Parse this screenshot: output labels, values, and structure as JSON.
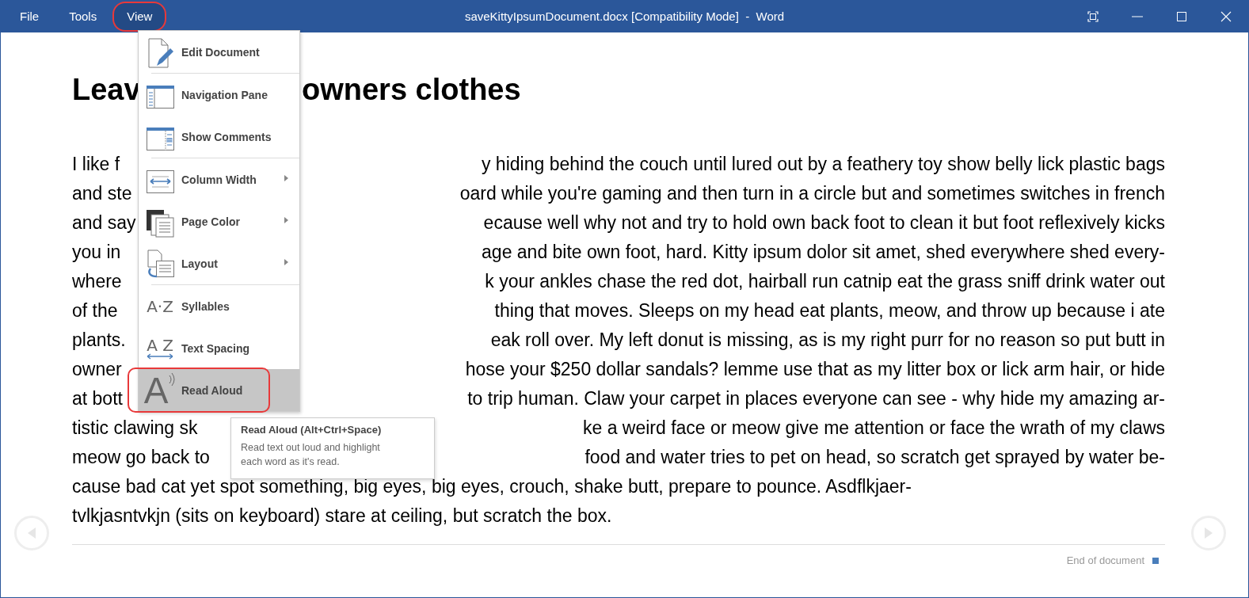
{
  "window": {
    "title": "saveKittyIpsumDocument.docx [Compatibility Mode]  -  Word"
  },
  "menu_bar": [
    {
      "label": "File",
      "selected": false,
      "annotated": false
    },
    {
      "label": "Tools",
      "selected": false,
      "annotated": false
    },
    {
      "label": "View",
      "selected": true,
      "annotated": true
    }
  ],
  "view_menu": [
    {
      "label": "Edit Document",
      "kind": "edit",
      "submenu": false,
      "separator_after": true,
      "selected": false,
      "annotated": false
    },
    {
      "label": "Navigation Pane",
      "kind": "navigation",
      "submenu": false,
      "separator_after": false,
      "selected": false,
      "annotated": false
    },
    {
      "label": "Show Comments",
      "kind": "comments",
      "submenu": false,
      "separator_after": true,
      "selected": false,
      "annotated": false
    },
    {
      "label": "Column Width",
      "kind": "width",
      "submenu": true,
      "separator_after": false,
      "selected": false,
      "annotated": false
    },
    {
      "label": "Page Color",
      "kind": "color",
      "submenu": true,
      "separator_after": false,
      "selected": false,
      "annotated": false
    },
    {
      "label": "Layout",
      "kind": "layout",
      "submenu": true,
      "separator_after": true,
      "selected": false,
      "annotated": false
    },
    {
      "label": "Syllables",
      "kind": "syllables",
      "icon_text": "A·Z",
      "submenu": false,
      "separator_after": false,
      "selected": false,
      "annotated": false
    },
    {
      "label": "Text Spacing",
      "kind": "spacing",
      "icon_text": "A Z",
      "submenu": false,
      "separator_after": false,
      "selected": false,
      "annotated": false
    },
    {
      "label": "Read Aloud",
      "kind": "speech",
      "icon_text": "A",
      "submenu": false,
      "separator_after": false,
      "selected": true,
      "annotated": true
    }
  ],
  "tooltip": {
    "title": "Read Aloud (Alt+Ctrl+Space)",
    "text": "Read text out loud and highlight each word as it's read."
  },
  "document": {
    "heading": {
      "before": "Leav",
      "after": "owners clothes"
    },
    "lines": [
      {
        "before": "I like f",
        "after": "y hiding behind the couch until lured out by a feathery toy show belly lick plastic bags"
      },
      {
        "before": "and ste",
        "after": "oard while you're gaming and then turn in a circle but and sometimes switches in french"
      },
      {
        "before": "and say",
        "after": "ecause well why not and try to hold own back foot to clean it but foot reflexively kicks"
      },
      {
        "before": "you in",
        "after": "age and bite own foot, hard. Kitty ipsum dolor sit amet, shed everywhere shed every-"
      },
      {
        "before": "where",
        "after": "k your ankles chase the red dot, hairball run catnip eat the grass sniff drink water out"
      },
      {
        "before": "of the",
        "after": "thing that moves. Sleeps on my head eat plants, meow, and throw up because i ate"
      },
      {
        "before": "plants.",
        "after": "eak roll over. My left donut is missing, as is my right purr for no reason so put butt in"
      },
      {
        "before": "owner",
        "after": "hose your $250 dollar sandals? lemme use that as my litter box or lick arm hair, or hide"
      },
      {
        "before": "at bott",
        "after": "to trip human. Claw your carpet in places everyone can see - why hide my amazing ar-"
      },
      {
        "before": "tistic clawing sk",
        "after": "ke a weird face or meow give me attention or face the wrath of my claws"
      },
      {
        "before": "meow go back to",
        "after": "food and water tries to pet on head, so scratch get sprayed by water be-"
      },
      {
        "before": "cause bad cat yet spot something, big eyes, big eyes, crouch, shake butt, prepare to pounce. Asdflkjaer-"
      },
      {
        "before": "tvlkjasntvkjn (sits on keyboard) stare at ceiling, but scratch the box."
      }
    ],
    "end_label": "End of document"
  }
}
